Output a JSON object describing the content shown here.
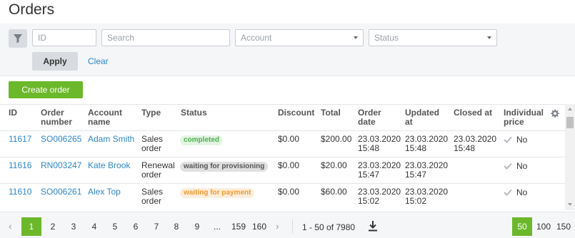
{
  "page": {
    "title": "Orders"
  },
  "filters": {
    "id_placeholder": "ID",
    "search_placeholder": "Search",
    "account_placeholder": "Account",
    "status_placeholder": "Status",
    "apply_label": "Apply",
    "clear_label": "Clear"
  },
  "actions": {
    "create_label": "Create order"
  },
  "table": {
    "headers": {
      "id": "ID",
      "order_number": "Order number",
      "account_name": "Account name",
      "type": "Type",
      "status": "Status",
      "discount": "Discount",
      "total": "Total",
      "order_date": "Order date",
      "updated_at": "Updated at",
      "closed_at": "Closed at",
      "individual_price": "Individual price"
    },
    "rows": [
      {
        "id": "11617",
        "order_number": "SO006265",
        "account": "Adam Smith",
        "type": "Sales order",
        "status": "completed",
        "status_color": "#4caf50",
        "status_bg": "#e3f4e3",
        "discount": "$0.00",
        "total": "$200.00",
        "order_date": "23.03.2020 15:48",
        "updated_at": "23.03.2020 15:48",
        "closed_at": "23.03.2020 15:48",
        "individual": "No"
      },
      {
        "id": "11616",
        "order_number": "RN003247",
        "account": "Kate Brook",
        "type": "Renewal order",
        "status": "waiting for provisioning",
        "status_color": "#555555",
        "status_bg": "#e0e0e0",
        "discount": "$0.00",
        "total": "$20.00",
        "order_date": "23.03.2020 15:47",
        "updated_at": "23.03.2020 15:47",
        "closed_at": "",
        "individual": "No"
      },
      {
        "id": "11610",
        "order_number": "SO006261",
        "account": "Alex Top",
        "type": "Sales order",
        "status": "waiting for payment",
        "status_color": "#f29a2e",
        "status_bg": "#fdeedd",
        "discount": "$0.00",
        "total": "$60.00",
        "order_date": "23.03.2020 15:02",
        "updated_at": "23.03.2020 15:02",
        "closed_at": "",
        "individual": "No"
      }
    ]
  },
  "pagination": {
    "pages": [
      "1",
      "2",
      "3",
      "4",
      "5",
      "6",
      "7",
      "8",
      "9",
      "...",
      "159",
      "160"
    ],
    "current": "1",
    "range_text": "1 - 50 of 7980",
    "page_sizes": [
      "50",
      "100",
      "150"
    ],
    "current_size": "50"
  },
  "colors": {
    "accent": "#6cb82b",
    "link": "#2f86c8"
  },
  "icons": [
    "filter-icon",
    "gear-icon",
    "checkmark-icon",
    "download-icon",
    "chevron-left-icon",
    "chevron-right-icon"
  ]
}
